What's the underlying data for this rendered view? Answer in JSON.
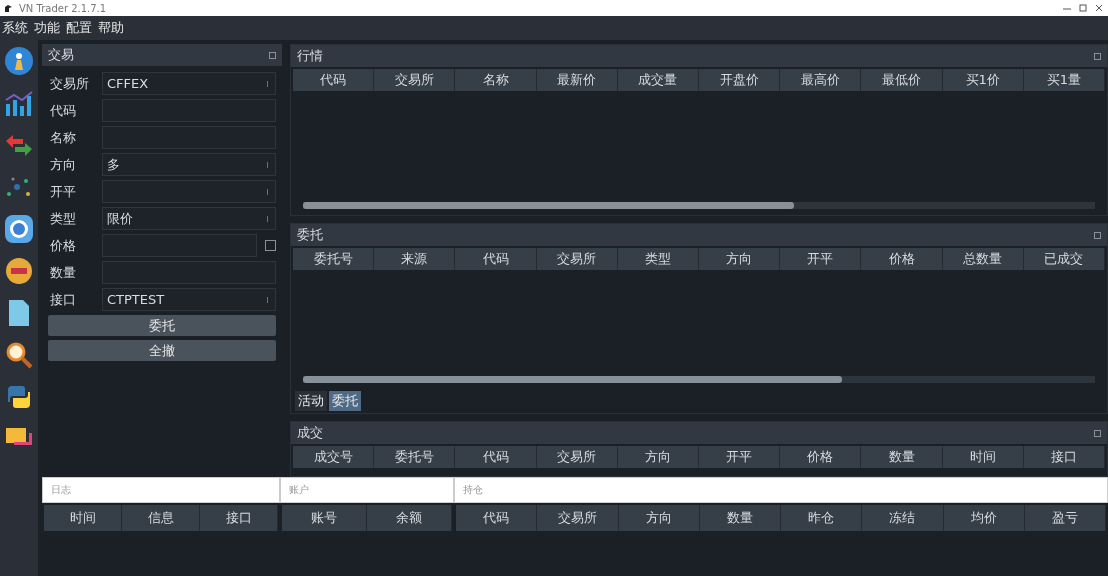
{
  "window": {
    "title": "VN Trader 2.1.7.1"
  },
  "menu": [
    "系统",
    "功能",
    "配置",
    "帮助"
  ],
  "trade_panel": {
    "title": "交易",
    "fields": [
      {
        "label": "交易所",
        "kind": "combo",
        "value": "CFFEX"
      },
      {
        "label": "代码",
        "kind": "input"
      },
      {
        "label": "名称",
        "kind": "input"
      },
      {
        "label": "方向",
        "kind": "combo",
        "value": "多"
      },
      {
        "label": "开平",
        "kind": "combo"
      },
      {
        "label": "类型",
        "kind": "combo",
        "value": "限价"
      },
      {
        "label": "价格",
        "kind": "check",
        "checked": false
      },
      {
        "label": "数量",
        "kind": "input"
      },
      {
        "label": "接口",
        "kind": "combo",
        "value": "CTPTEST"
      }
    ],
    "buttons": [
      "委托",
      "全撤"
    ]
  },
  "market": {
    "title": "行情",
    "columns": [
      "代码",
      "交易所",
      "名称",
      "最新价",
      "成交量",
      "开盘价",
      "最高价",
      "最低价",
      "买1价",
      "买1量"
    ]
  },
  "orders": {
    "title": "委托",
    "columns": [
      "委托号",
      "来源",
      "代码",
      "交易所",
      "类型",
      "方向",
      "开平",
      "价格",
      "总数量",
      "已成交"
    ],
    "tabs": [
      {
        "label": "活动",
        "selected": false
      },
      {
        "label": "委托",
        "selected": true
      }
    ]
  },
  "trades": {
    "title": "成交",
    "columns": [
      "成交号",
      "委托号",
      "代码",
      "交易所",
      "方向",
      "开平",
      "价格",
      "数量",
      "时间",
      "接口"
    ]
  },
  "log": {
    "title": "日志",
    "columns": [
      "时间",
      "信息",
      "接口"
    ]
  },
  "account": {
    "title": "账户",
    "columns": [
      "账号",
      "余额"
    ]
  },
  "position": {
    "title": "持仓",
    "columns": [
      "代码",
      "交易所",
      "方向",
      "数量",
      "昨仓",
      "冻结",
      "均价",
      "盈亏"
    ]
  }
}
